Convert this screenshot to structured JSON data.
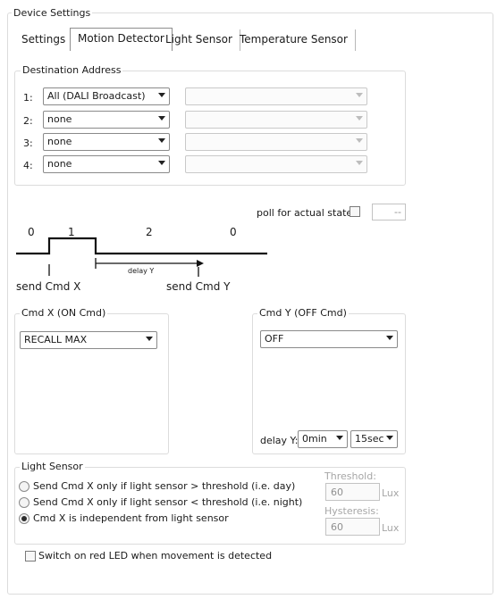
{
  "window": {
    "title": "Device Settings"
  },
  "tabs": [
    {
      "label": "Settings"
    },
    {
      "label": "Motion Detector"
    },
    {
      "label": "Light Sensor"
    },
    {
      "label": "Temperature Sensor"
    }
  ],
  "destination": {
    "title": "Destination Address",
    "rows": [
      {
        "num": "1:",
        "value": "All (DALI Broadcast)"
      },
      {
        "num": "2:",
        "value": "none"
      },
      {
        "num": "3:",
        "value": "none"
      },
      {
        "num": "4:",
        "value": "none"
      }
    ]
  },
  "poll": {
    "label": "poll for actual state:",
    "value": "--"
  },
  "timing": {
    "states": [
      "0",
      "1",
      "2",
      "0"
    ],
    "send_x": "send Cmd X",
    "send_y": "send Cmd Y",
    "delay_label": "delay Y"
  },
  "cmd_x": {
    "title": "Cmd X  (ON Cmd)",
    "value": "RECALL MAX"
  },
  "cmd_y": {
    "title": "Cmd Y  (OFF Cmd)",
    "value": "OFF",
    "delay_label": "delay Y:",
    "delay_min": "0min",
    "delay_sec": "15sec"
  },
  "light_sensor": {
    "title": "Light Sensor",
    "options": [
      "Send Cmd X only if light sensor > threshold (i.e. day)",
      "Send Cmd X only if light sensor < threshold (i.e. night)",
      "Cmd X is independent from light sensor"
    ],
    "selected_index": 2,
    "threshold_label": "Threshold:",
    "threshold_value": "60",
    "hysteresis_label": "Hysteresis:",
    "hysteresis_value": "60",
    "unit": "Lux"
  },
  "led": {
    "label": "Switch on red LED when movement is detected"
  }
}
